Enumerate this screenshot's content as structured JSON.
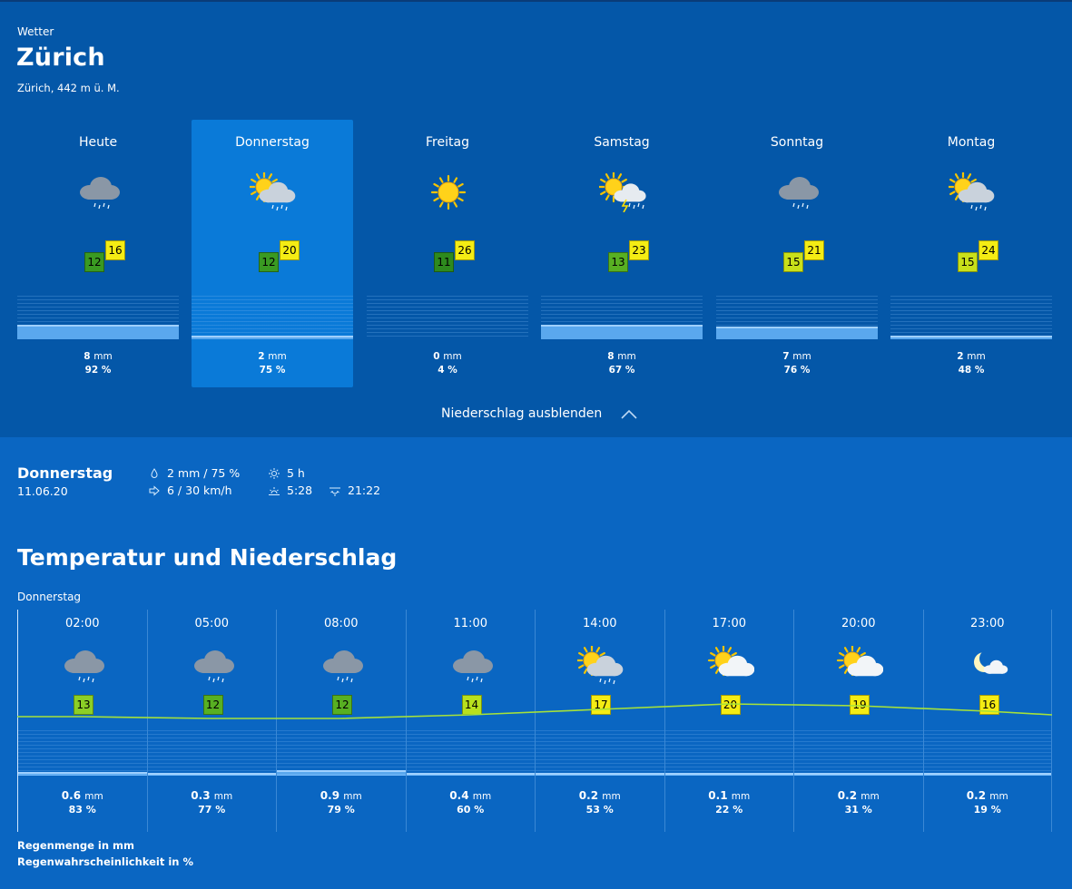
{
  "header": {
    "breadcrumb": "Wetter",
    "city": "Zürich",
    "altitude": "Zürich, 442 m ü. M."
  },
  "colors": {
    "temp_green_dark": "#3a9a22",
    "temp_green": "#8ccf26",
    "temp_yellow": "#f4ec14",
    "temp_line": "#a6e23a",
    "accent_selected": "#0a7ad8"
  },
  "days": [
    {
      "name": "Heute",
      "icon": "rain-cloud-icon",
      "tmin": "12",
      "tmax": "16",
      "mm": "8",
      "unit": "mm",
      "pct": "92 %",
      "precip_level": 0.33,
      "tmin_color": "#3a9a22",
      "selected": false
    },
    {
      "name": "Donnerstag",
      "icon": "sun-cloud-rain-icon",
      "tmin": "12",
      "tmax": "20",
      "mm": "2",
      "unit": "mm",
      "pct": "75 %",
      "precip_level": 0.08,
      "tmin_color": "#3a9a22",
      "selected": true
    },
    {
      "name": "Freitag",
      "icon": "sun-icon",
      "tmin": "11",
      "tmax": "26",
      "mm": "0",
      "unit": "mm",
      "pct": "4 %",
      "precip_level": 0,
      "tmin_color": "#2e8a1e",
      "selected": false
    },
    {
      "name": "Samstag",
      "icon": "sun-cloud-thunder-icon",
      "tmin": "13",
      "tmax": "23",
      "mm": "8",
      "unit": "mm",
      "pct": "67 %",
      "precip_level": 0.33,
      "tmin_color": "#58b022",
      "selected": false
    },
    {
      "name": "Sonntag",
      "icon": "rain-cloud-icon",
      "tmin": "15",
      "tmax": "21",
      "mm": "7",
      "unit": "mm",
      "pct": "76 %",
      "precip_level": 0.29,
      "tmin_color": "#c8e01a",
      "selected": false
    },
    {
      "name": "Montag",
      "icon": "sun-cloud-rain-icon",
      "tmin": "15",
      "tmax": "24",
      "mm": "2",
      "unit": "mm",
      "pct": "48 %",
      "precip_level": 0.08,
      "tmin_color": "#c8e01a",
      "selected": false
    }
  ],
  "toggle_label": "Niederschlag ausblenden",
  "summary": {
    "day": "Donnerstag",
    "date": "11.06.20",
    "precip": "2 mm / 75 %",
    "wind": "6 / 30 km/h",
    "sunshine": "5 h",
    "sunrise": "5:28",
    "sunset": "21:22"
  },
  "section_title": "Temperatur und Niederschlag",
  "section_subtitle": "Donnerstag",
  "hourly": [
    {
      "time": "02:00",
      "icon": "rain-cloud-icon",
      "temp": 13,
      "mm": "0.6",
      "pct": "83 %",
      "precip_level": 0.06,
      "temp_color": "#8ccf26"
    },
    {
      "time": "05:00",
      "icon": "rain-cloud-icon",
      "temp": 12,
      "mm": "0.3",
      "pct": "77 %",
      "precip_level": 0.03,
      "temp_color": "#58b022"
    },
    {
      "time": "08:00",
      "icon": "rain-cloud-icon",
      "temp": 12,
      "mm": "0.9",
      "pct": "79 %",
      "precip_level": 0.09,
      "temp_color": "#58b022"
    },
    {
      "time": "11:00",
      "icon": "rain-cloud-icon",
      "temp": 14,
      "mm": "0.4",
      "pct": "60 %",
      "precip_level": 0.04,
      "temp_color": "#b8e01e"
    },
    {
      "time": "14:00",
      "icon": "sun-cloud-rain-icon",
      "temp": 17,
      "mm": "0.2",
      "pct": "53 %",
      "precip_level": 0.02,
      "temp_color": "#f4ec14"
    },
    {
      "time": "17:00",
      "icon": "sun-cloud-icon",
      "temp": 20,
      "mm": "0.1",
      "pct": "22 %",
      "precip_level": 0.01,
      "temp_color": "#f4ec14"
    },
    {
      "time": "20:00",
      "icon": "sun-cloud-icon",
      "temp": 19,
      "mm": "0.2",
      "pct": "31 %",
      "precip_level": 0.02,
      "temp_color": "#f4ec14"
    },
    {
      "time": "23:00",
      "icon": "moon-cloud-icon",
      "temp": 16,
      "mm": "0.2",
      "pct": "19 %",
      "precip_level": 0.02,
      "temp_color": "#f4ec14"
    }
  ],
  "unit_mm": "mm",
  "legend": {
    "amount": "Regenmenge in mm",
    "probability": "Regenwahrscheinlichkeit in %"
  }
}
